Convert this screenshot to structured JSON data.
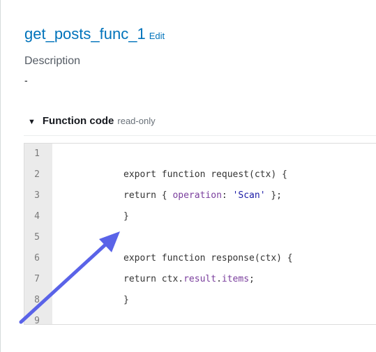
{
  "function": {
    "name": "get_posts_func_1",
    "edit_label": "Edit"
  },
  "description": {
    "label": "Description",
    "value": "-"
  },
  "code_section": {
    "title": "Function code",
    "note": "read-only",
    "lines": [
      {
        "num": "1",
        "parts": []
      },
      {
        "num": "2",
        "parts": [
          "export function request(ctx) {"
        ]
      },
      {
        "num": "3",
        "parts": [
          "return { ",
          "operation",
          ": ",
          "'Scan'",
          " };"
        ]
      },
      {
        "num": "4",
        "parts": [
          "}"
        ]
      },
      {
        "num": "5",
        "parts": []
      },
      {
        "num": "6",
        "parts": [
          "export function response(ctx) {"
        ]
      },
      {
        "num": "7",
        "parts": [
          "return ctx.",
          "result",
          ".",
          "items",
          ";"
        ]
      },
      {
        "num": "8",
        "parts": [
          "}"
        ]
      },
      {
        "num": "9",
        "parts": []
      }
    ]
  },
  "colors": {
    "link": "#0073bb",
    "arrow": "#5a63e8",
    "keyword_prop": "#7a3e9d",
    "string": "#1a1aa6"
  },
  "icons": {
    "caret": "caret-down-icon",
    "annotation": "arrow-annotation-icon"
  }
}
